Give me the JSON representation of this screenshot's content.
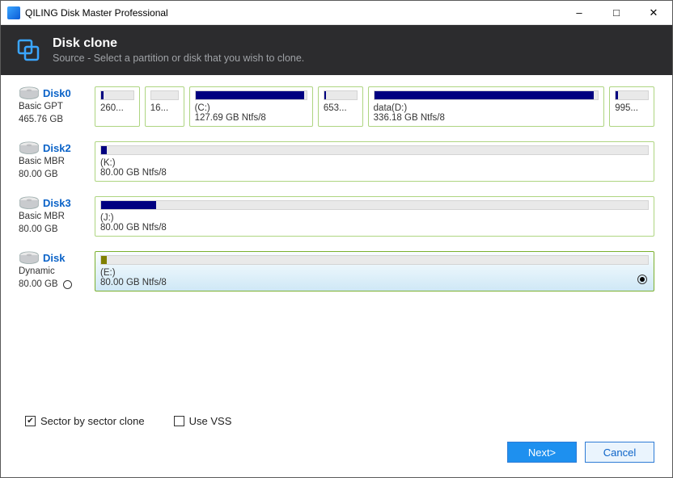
{
  "window": {
    "title": "QILING Disk Master Professional"
  },
  "header": {
    "title": "Disk clone",
    "subtitle": "Source - Select a partition or disk that you wish to clone."
  },
  "disks": [
    {
      "name": "Disk0",
      "type": "Basic GPT",
      "size": "465.76 GB",
      "selected": false,
      "parts": [
        {
          "label": "",
          "size": "260...",
          "fill": 8,
          "flex": 6,
          "color": "navy"
        },
        {
          "label": "",
          "size": "16...",
          "fill": 0,
          "flex": 5,
          "color": "navy"
        },
        {
          "label": "(C:)",
          "size": "127.69 GB Ntfs/8",
          "fill": 98,
          "flex": 20,
          "color": "navy"
        },
        {
          "label": "",
          "size": "653...",
          "fill": 6,
          "flex": 6,
          "color": "navy"
        },
        {
          "label": "data(D:)",
          "size": "336.18 GB Ntfs/8",
          "fill": 98,
          "flex": 40,
          "color": "navy"
        },
        {
          "label": "",
          "size": "995...",
          "fill": 6,
          "flex": 6,
          "color": "navy"
        }
      ]
    },
    {
      "name": "Disk2",
      "type": "Basic MBR",
      "size": "80.00 GB",
      "selected": false,
      "parts": [
        {
          "label": "(K:)",
          "size": "80.00 GB Ntfs/8",
          "fill": 1,
          "flex": 100,
          "color": "navy"
        }
      ]
    },
    {
      "name": "Disk3",
      "type": "Basic MBR",
      "size": "80.00 GB",
      "selected": false,
      "parts": [
        {
          "label": "(J:)",
          "size": "80.00 GB Ntfs/8",
          "fill": 10,
          "flex": 100,
          "color": "navy"
        }
      ]
    },
    {
      "name": "Disk",
      "type": "Dynamic",
      "size": "80.00 GB",
      "selected": true,
      "showRadioLeft": true,
      "parts": [
        {
          "label": "(E:)",
          "size": "80.00 GB Ntfs/8",
          "fill": 1,
          "flex": 100,
          "color": "olive",
          "selected": true
        }
      ]
    }
  ],
  "options": {
    "sector": {
      "label": "Sector by sector clone",
      "checked": true
    },
    "vss": {
      "label": "Use VSS",
      "checked": false
    }
  },
  "buttons": {
    "next": "Next>",
    "cancel": "Cancel"
  }
}
